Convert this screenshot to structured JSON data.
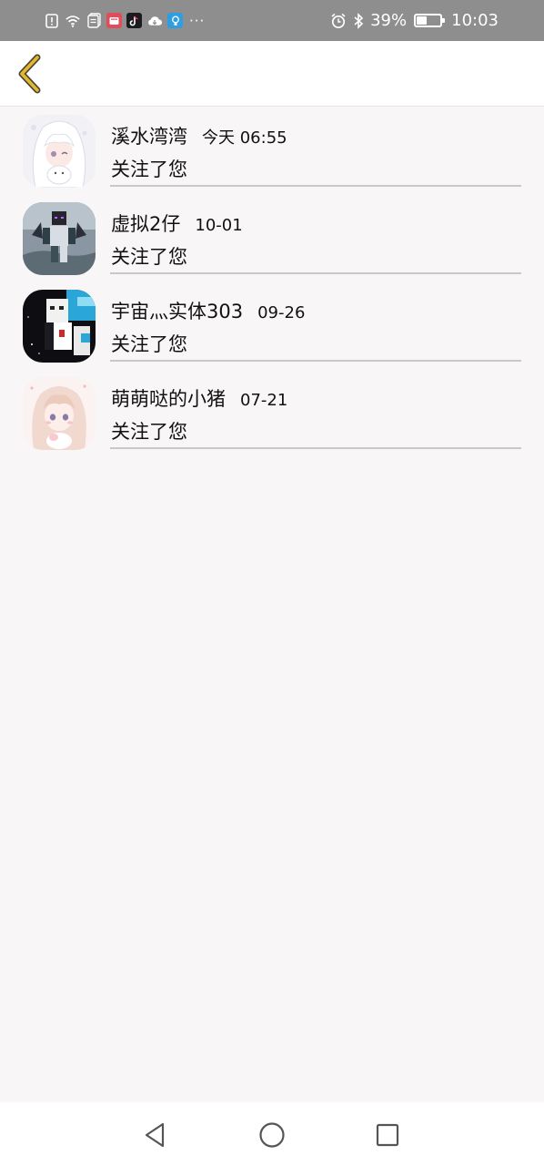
{
  "status_bar": {
    "battery_percent": "39%",
    "battery_level": 0.39,
    "time": "10:03",
    "left_icons": [
      "alert-icon",
      "wifi-icon",
      "document-icon",
      "red-app-icon",
      "tiktok-icon",
      "cloud-icon",
      "bulb-app-icon"
    ],
    "overflow": "···"
  },
  "header": {
    "back_icon": "chevron-left-icon",
    "accent_color": "#e2b92e"
  },
  "notifications": [
    {
      "name": "溪水湾湾",
      "time": "今天 06:55",
      "action": "关注了您",
      "avatar": "anime-girl-white-hair"
    },
    {
      "name": "虚拟2仔",
      "time": "10-01",
      "action": "关注了您",
      "avatar": "minecraft-dark-skin"
    },
    {
      "name": "宇宙灬实体303",
      "time": "09-26",
      "action": "关注了您",
      "avatar": "minecraft-black-white-blue"
    },
    {
      "name": "萌萌哒的小猪",
      "time": "07-21",
      "action": "关注了您",
      "avatar": "anime-girl-pink-hair"
    }
  ],
  "nav": {
    "back": "triangle-back-icon",
    "home": "circle-home-icon",
    "recents": "square-recents-icon"
  }
}
